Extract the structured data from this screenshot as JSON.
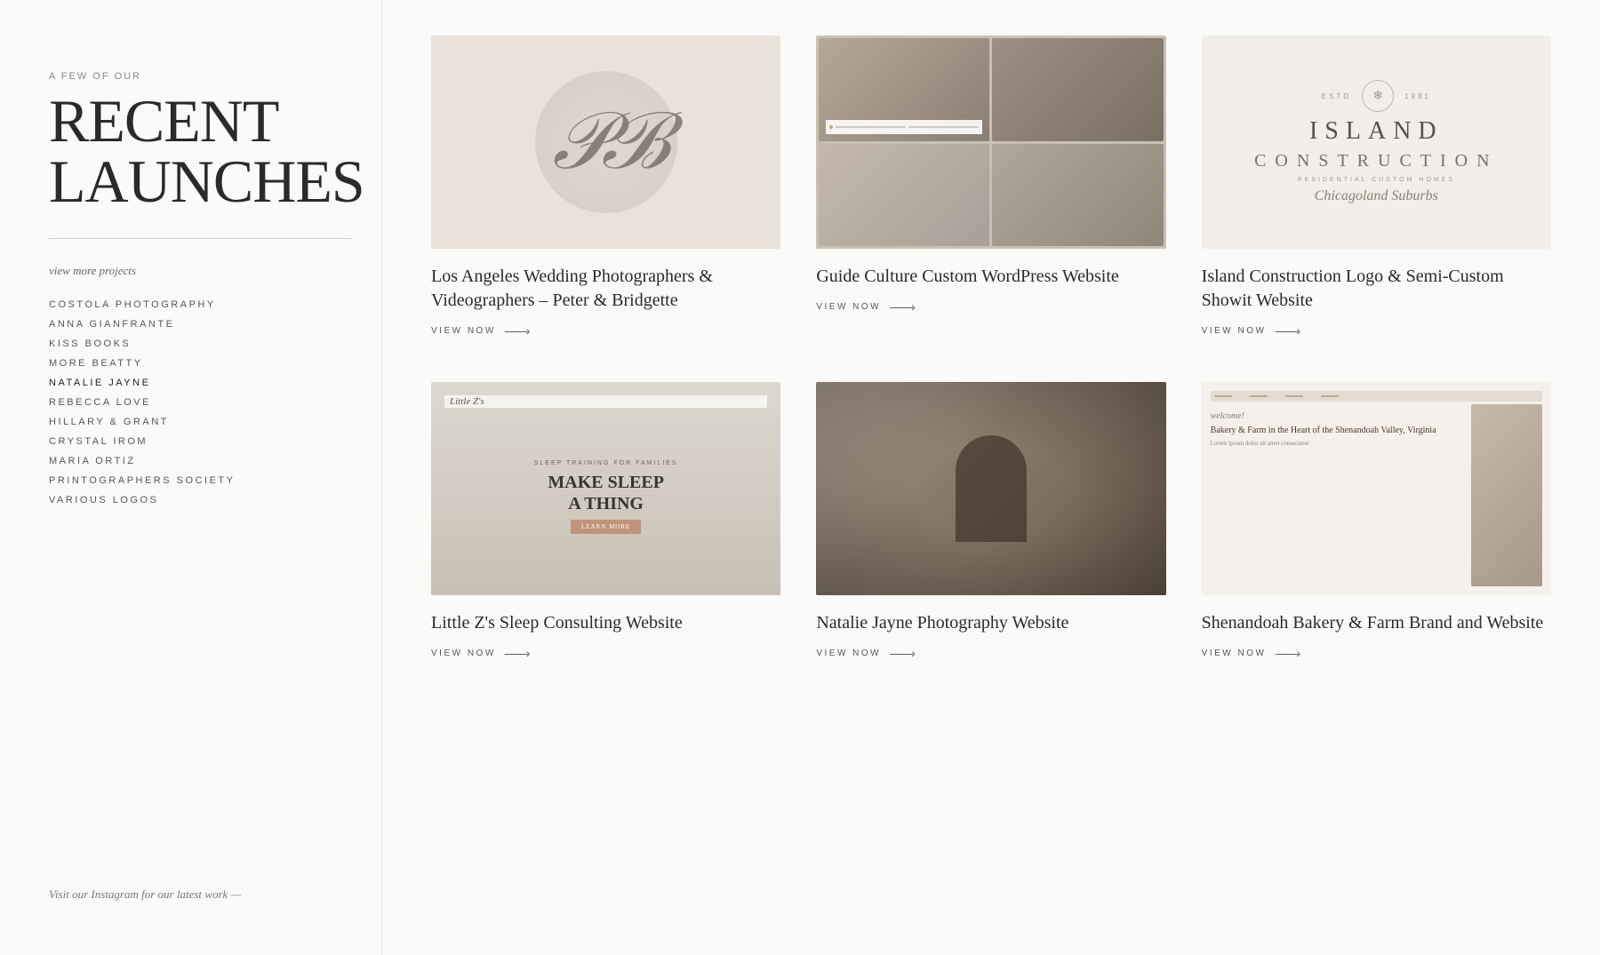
{
  "sidebar": {
    "eyebrow": "A FEW OF OUR",
    "title_line1": "RECENT",
    "title_line2": "LAUNCHES",
    "view_more": "view more projects",
    "nav_items": [
      {
        "id": "costola-photography",
        "label": "COSTOLA PHOTOGRAPHY"
      },
      {
        "id": "anna-gianfrante",
        "label": "ANNA GIANFRANTE"
      },
      {
        "id": "kiss-books",
        "label": "KISS BOOKS"
      },
      {
        "id": "more-beatty",
        "label": "MORE BEATTY"
      },
      {
        "id": "natalie-jayne",
        "label": "NATALIE JAYNE",
        "active": true
      },
      {
        "id": "rebecca-love",
        "label": "REBECCA LOVE"
      },
      {
        "id": "hillary-grant",
        "label": "HILLARY & GRANT"
      },
      {
        "id": "crystal-irom",
        "label": "CRYSTAL IROM"
      },
      {
        "id": "maria-ortiz",
        "label": "MARIA ORTIZ"
      },
      {
        "id": "printographers-society",
        "label": "PRINTOGRAPHERS SOCIETY"
      },
      {
        "id": "various-logos",
        "label": "VARIOUS LOGOS"
      }
    ],
    "instagram_note": "Visit our Instagram for our latest work —"
  },
  "projects": [
    {
      "id": "peter-bridgette",
      "title": "Los Angeles Wedding Photographers & Videographers – Peter & Bridgette",
      "link_label": "VIEW NOW",
      "image_type": "peter-bridgette"
    },
    {
      "id": "guide-culture",
      "title": "Guide Culture Custom WordPress Website",
      "link_label": "VIEW NOW",
      "image_type": "guide-culture"
    },
    {
      "id": "island-construction",
      "title": "Island Construction Logo & Semi-Custom Showit Website",
      "link_label": "VIEW NOW",
      "image_type": "island-construction"
    },
    {
      "id": "little-zs",
      "title": "Little Z's Sleep Consulting Website",
      "link_label": "VIEW NOW",
      "image_type": "little-zs"
    },
    {
      "id": "couple",
      "title": "Natalie Jayne Photography Website",
      "link_label": "VIEW NOW",
      "image_type": "couple"
    },
    {
      "id": "bakery",
      "title": "Shenandoah Bakery & Farm Brand and Website",
      "link_label": "VIEW NOW",
      "image_type": "bakery"
    }
  ],
  "icons": {
    "arrow": "———›"
  }
}
